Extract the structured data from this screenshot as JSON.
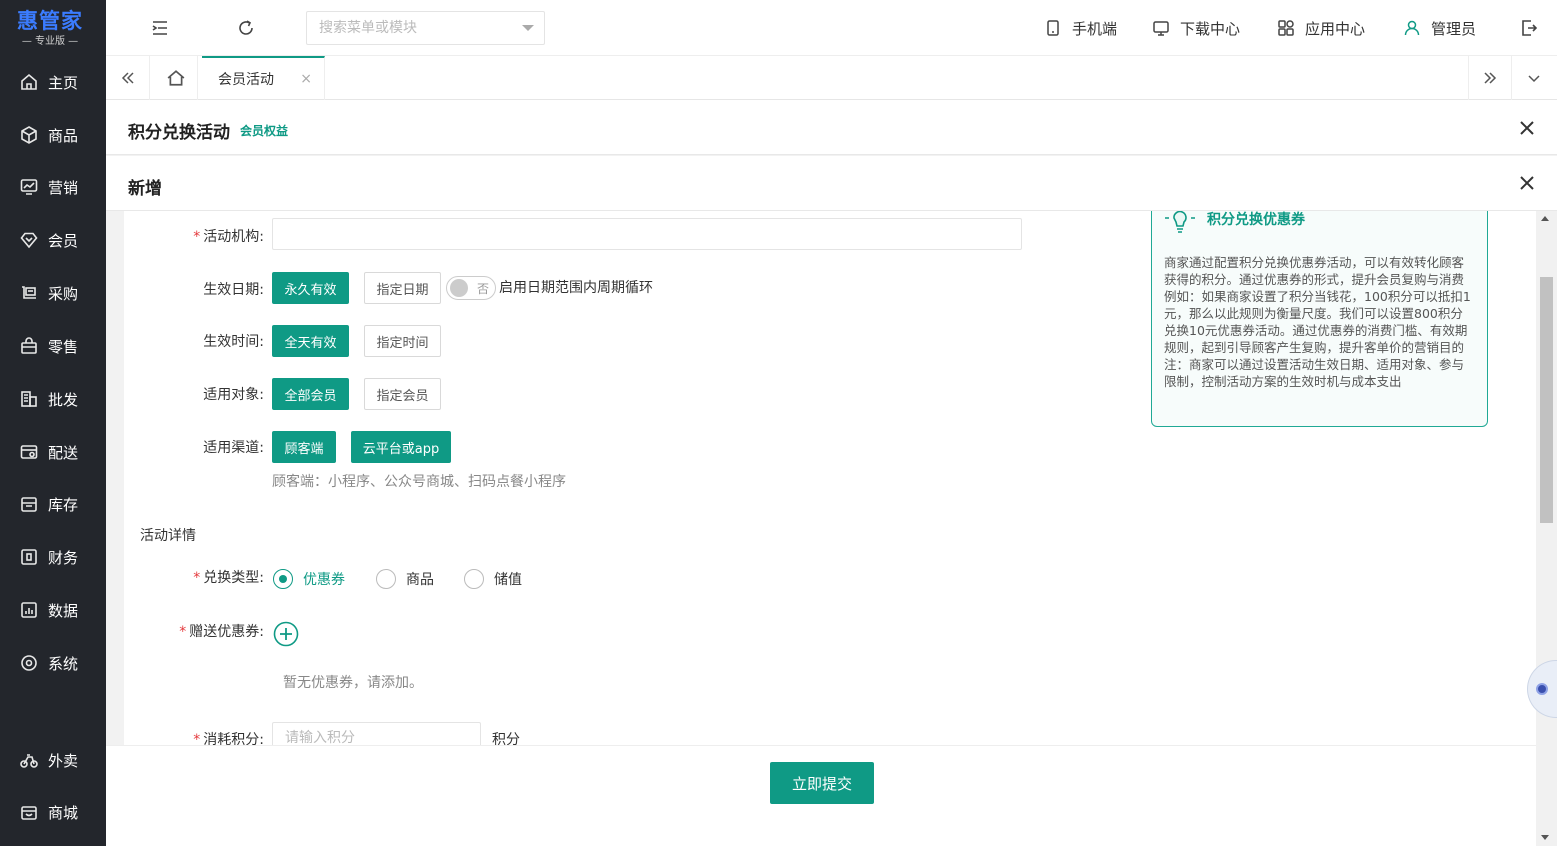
{
  "brand": {
    "name": "惠管家",
    "edition": "专业版"
  },
  "sidebar": {
    "items": [
      {
        "label": "主页",
        "icon": "home-icon"
      },
      {
        "label": "商品",
        "icon": "box-icon"
      },
      {
        "label": "营销",
        "icon": "chart-screen-icon"
      },
      {
        "label": "会员",
        "icon": "diamond-icon"
      },
      {
        "label": "采购",
        "icon": "cart-icon"
      },
      {
        "label": "零售",
        "icon": "bag-icon"
      },
      {
        "label": "批发",
        "icon": "building-icon"
      },
      {
        "label": "配送",
        "icon": "delivery-icon"
      },
      {
        "label": "库存",
        "icon": "warehouse-icon"
      },
      {
        "label": "财务",
        "icon": "finance-icon"
      },
      {
        "label": "数据",
        "icon": "data-icon"
      },
      {
        "label": "系统",
        "icon": "settings-icon"
      }
    ],
    "bottom_items": [
      {
        "label": "外卖",
        "icon": "bike-icon"
      },
      {
        "label": "商城",
        "icon": "store-icon"
      }
    ]
  },
  "topbar": {
    "search_placeholder": "搜索菜单或模块",
    "mobile": "手机端",
    "download": "下载中心",
    "apps": "应用中心",
    "user": "管理员"
  },
  "tabs": {
    "active": "会员活动"
  },
  "panel": {
    "title": "积分兑换活动",
    "subtitle": "会员权益"
  },
  "dialog": {
    "title": "新增"
  },
  "form": {
    "org_label": "活动机构:",
    "date_label": "生效日期:",
    "date_opt1": "永久有效",
    "date_opt2": "指定日期",
    "toggle_text": "否",
    "cycle_label": "启用日期范围内周期循环",
    "time_label": "生效时间:",
    "time_opt1": "全天有效",
    "time_opt2": "指定时间",
    "target_label": "适用对象:",
    "target_opt1": "全部会员",
    "target_opt2": "指定会员",
    "channel_label": "适用渠道:",
    "channel_opt1": "顾客端",
    "channel_opt2": "云平台或app",
    "channel_hint": "顾客端：小程序、公众号商城、扫码点餐小程序",
    "section_title": "活动详情",
    "exchange_label": "兑换类型:",
    "exchange_opts": [
      "优惠券",
      "商品",
      "储值"
    ],
    "coupon_label": "赠送优惠券:",
    "coupon_empty": "暂无优惠券，请添加。",
    "points_label": "消耗积分:",
    "points_placeholder": "请输入积分",
    "points_unit": "积分"
  },
  "tip": {
    "title": "积分兑换优惠券",
    "body": "商家通过配置积分兑换优惠券活动，可以有效转化顾客获得的积分。通过优惠券的形式，提升会员复购与消费\n例如：如果商家设置了积分当钱花，100积分可以抵扣1元，那么以此规则为衡量尺度。我们可以设置800积分兑换10元优惠券活动。通过优惠券的消费门槛、有效期规则，起到引导顾客产生复购，提升客单价的营销目的\n注：商家可以通过设置活动生效日期、适用对象、参与限制，控制活动方案的生效时机与成本支出"
  },
  "footer": {
    "submit": "立即提交"
  },
  "colors": {
    "accent": "#0f9a85",
    "sidebar": "#23262c",
    "brand_blue": "#3b7cff"
  }
}
